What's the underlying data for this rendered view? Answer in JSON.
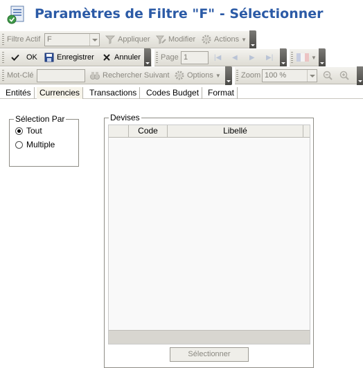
{
  "window": {
    "title": "Paramètres de Filtre \"F\" - Sélectionner"
  },
  "toolbar1": {
    "active_filter_label": "Filtre Actif",
    "active_filter_value": "F",
    "apply_label": "Appliquer",
    "modify_label": "Modifier",
    "actions_label": "Actions"
  },
  "toolbar2": {
    "ok_label": "OK",
    "save_label": "Enregistrer",
    "cancel_label": "Annuler",
    "page_label": "Page",
    "page_value": "1"
  },
  "toolbar3": {
    "keyword_label": "Mot-Clé",
    "keyword_value": "",
    "search_next_label": "Rechercher Suivant",
    "options_label": "Options",
    "zoom_label": "Zoom",
    "zoom_value": "100 %"
  },
  "tabs": [
    {
      "label": "Entités"
    },
    {
      "label": "Currencies"
    },
    {
      "label": "Transactions"
    },
    {
      "label": "Codes Budget"
    },
    {
      "label": "Format"
    }
  ],
  "selection": {
    "legend": "Sélection Par",
    "options": [
      {
        "label": "Tout",
        "checked": true
      },
      {
        "label": "Multiple",
        "checked": false
      }
    ]
  },
  "devises": {
    "legend": "Devises",
    "columns": [
      "Code",
      "Libellé"
    ],
    "rows": [],
    "select_button": "Sélectionner"
  },
  "colors": {
    "title": "#2b5aa6",
    "toolbar_bg": "#e4e2da",
    "active_tab_bg": "#f7f4ea"
  }
}
